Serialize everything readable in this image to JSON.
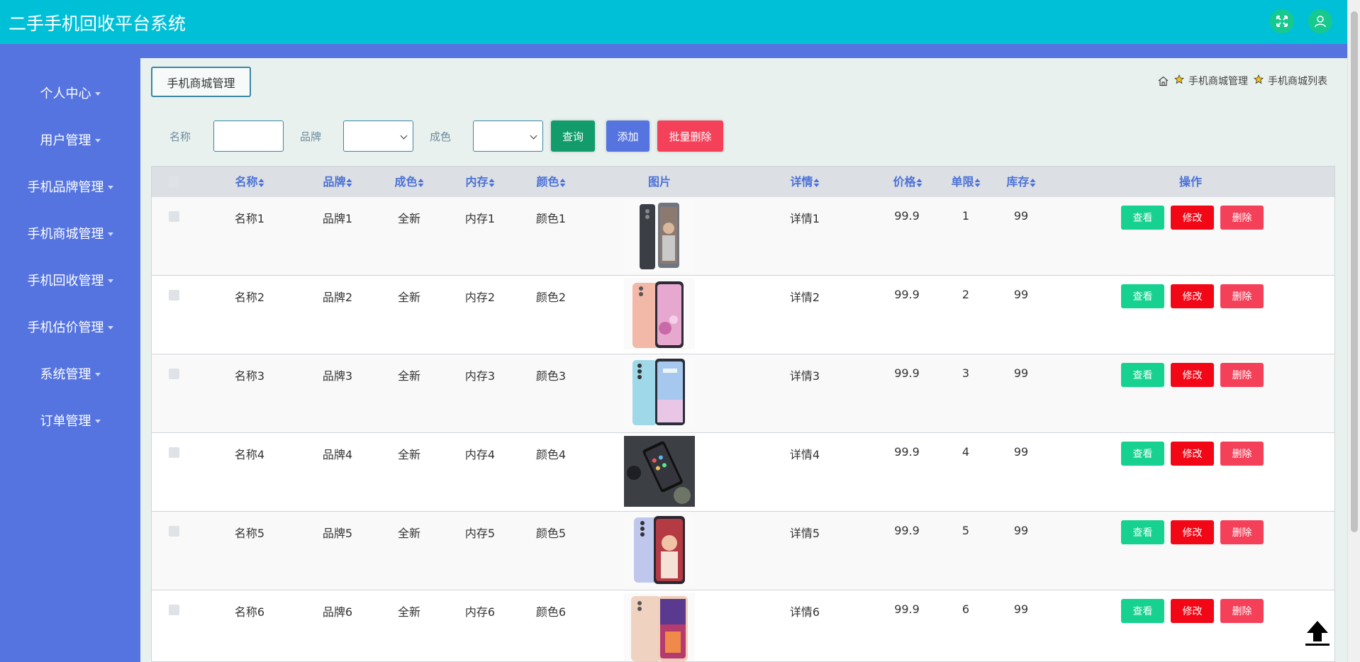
{
  "header": {
    "title": "二手手机回收平台系统",
    "bg_color": "#00c0d8",
    "icons": [
      "fullscreen-icon",
      "user-icon"
    ]
  },
  "sidebar": {
    "items": [
      {
        "label": "个人中心"
      },
      {
        "label": "用户管理"
      },
      {
        "label": "手机品牌管理"
      },
      {
        "label": "手机商城管理"
      },
      {
        "label": "手机回收管理"
      },
      {
        "label": "手机估价管理"
      },
      {
        "label": "系统管理"
      },
      {
        "label": "订单管理"
      }
    ]
  },
  "page": {
    "title_box": "手机商城管理",
    "breadcrumb": [
      "手机商城管理",
      "手机商城列表"
    ]
  },
  "search": {
    "name_label": "名称",
    "name_value": "",
    "brand_label": "品牌",
    "brand_value": "",
    "condition_label": "成色",
    "condition_value": "",
    "query_btn": "查询",
    "add_btn": "添加",
    "batch_delete_btn": "批量删除"
  },
  "table": {
    "headers": {
      "name": "名称",
      "brand": "品牌",
      "condition": "成色",
      "memory": "内存",
      "color": "颜色",
      "image": "图片",
      "detail": "详情",
      "price": "价格",
      "limit": "单限",
      "stock": "库存",
      "actions": "操作"
    },
    "row_buttons": {
      "view": "查看",
      "edit": "修改",
      "delete": "删除"
    },
    "rows": [
      {
        "name": "名称1",
        "brand": "品牌1",
        "condition": "全新",
        "memory": "内存1",
        "color": "颜色1",
        "detail": "详情1",
        "price": "99.9",
        "limit": "1",
        "stock": "99"
      },
      {
        "name": "名称2",
        "brand": "品牌2",
        "condition": "全新",
        "memory": "内存2",
        "color": "颜色2",
        "detail": "详情2",
        "price": "99.9",
        "limit": "2",
        "stock": "99"
      },
      {
        "name": "名称3",
        "brand": "品牌3",
        "condition": "全新",
        "memory": "内存3",
        "color": "颜色3",
        "detail": "详情3",
        "price": "99.9",
        "limit": "3",
        "stock": "99"
      },
      {
        "name": "名称4",
        "brand": "品牌4",
        "condition": "全新",
        "memory": "内存4",
        "color": "颜色4",
        "detail": "详情4",
        "price": "99.9",
        "limit": "4",
        "stock": "99"
      },
      {
        "name": "名称5",
        "brand": "品牌5",
        "condition": "全新",
        "memory": "内存5",
        "color": "颜色5",
        "detail": "详情5",
        "price": "99.9",
        "limit": "5",
        "stock": "99"
      },
      {
        "name": "名称6",
        "brand": "品牌6",
        "condition": "全新",
        "memory": "内存6",
        "color": "颜色6",
        "detail": "详情6",
        "price": "99.9",
        "limit": "6",
        "stock": "99"
      }
    ]
  },
  "colors": {
    "sidebar": "#5574e0",
    "header": "#00c0d8",
    "query_btn": "#129c6c",
    "add_btn": "#5574e0",
    "batch_delete_btn": "#f5405a",
    "view_btn": "#16d18f",
    "edit_btn": "#f20717",
    "delete_btn": "#f5405a"
  }
}
